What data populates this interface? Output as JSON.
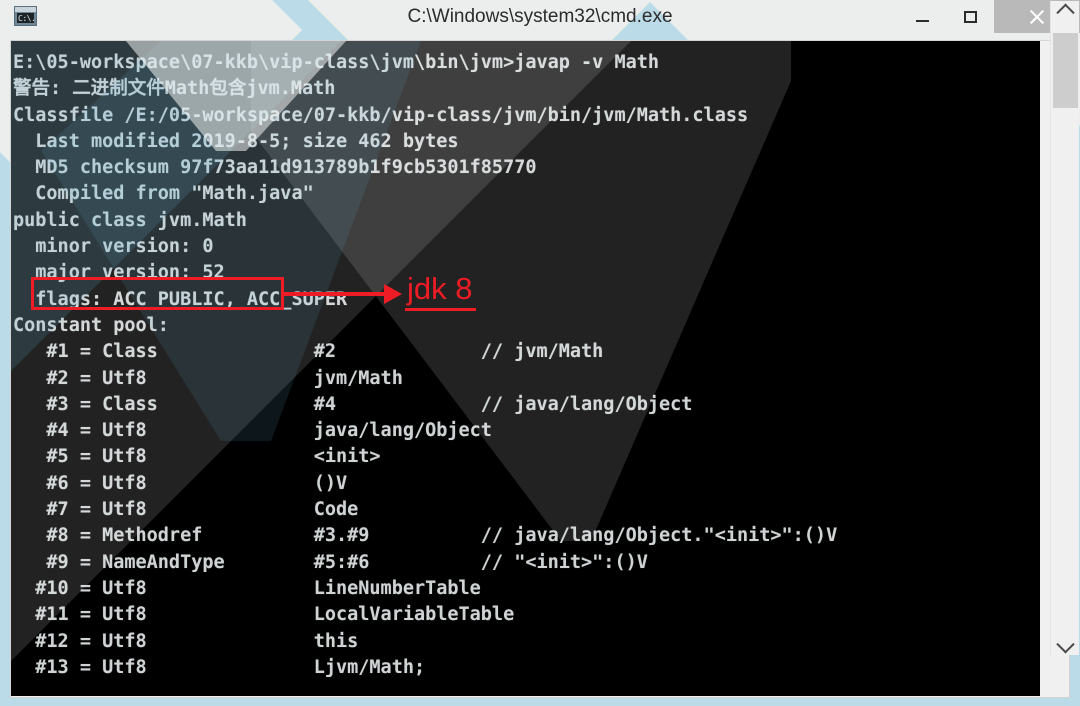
{
  "window": {
    "title": "C:\\Windows\\system32\\cmd.exe",
    "icon": "console-window-icon",
    "icon_text": "C:\\.",
    "controls": {
      "minimize_label": "Minimize",
      "maximize_label": "Maximize",
      "close_label": "Close"
    }
  },
  "console": {
    "background_color": "#000000",
    "text_color": "#cfd3d4",
    "lines": [
      "E:\\05-workspace\\07-kkb\\vip-class\\jvm\\bin\\jvm>javap -v Math",
      "警告: 二进制文件Math包含jvm.Math",
      "Classfile /E:/05-workspace/07-kkb/vip-class/jvm/bin/jvm/Math.class",
      "  Last modified 2019-8-5; size 462 bytes",
      "  MD5 checksum 97f73aa11d913789b1f9cb5301f85770",
      "  Compiled from \"Math.java\"",
      "public class jvm.Math",
      "  minor version: 0",
      "  major version: 52",
      "  flags: ACC_PUBLIC, ACC_SUPER",
      "Constant pool:",
      "   #1 = Class              #2             // jvm/Math",
      "   #2 = Utf8               jvm/Math",
      "   #3 = Class              #4             // java/lang/Object",
      "   #4 = Utf8               java/lang/Object",
      "   #5 = Utf8               <init>",
      "   #6 = Utf8               ()V",
      "   #7 = Utf8               Code",
      "   #8 = Methodref          #3.#9          // java/lang/Object.\"<init>\":()V",
      "   #9 = NameAndType        #5:#6          // \"<init>\":()V",
      "  #10 = Utf8               LineNumberTable",
      "  #11 = Utf8               LocalVariableTable",
      "  #12 = Utf8               this",
      "  #13 = Utf8               Ljvm/Math;"
    ]
  },
  "annotation": {
    "color": "#ee1c25",
    "highlighted_text": "major version: 52",
    "label": "jdk 8"
  },
  "scrollbar": {
    "up_arrow": "chevron-up-icon",
    "down_arrow": "chevron-down-icon"
  }
}
